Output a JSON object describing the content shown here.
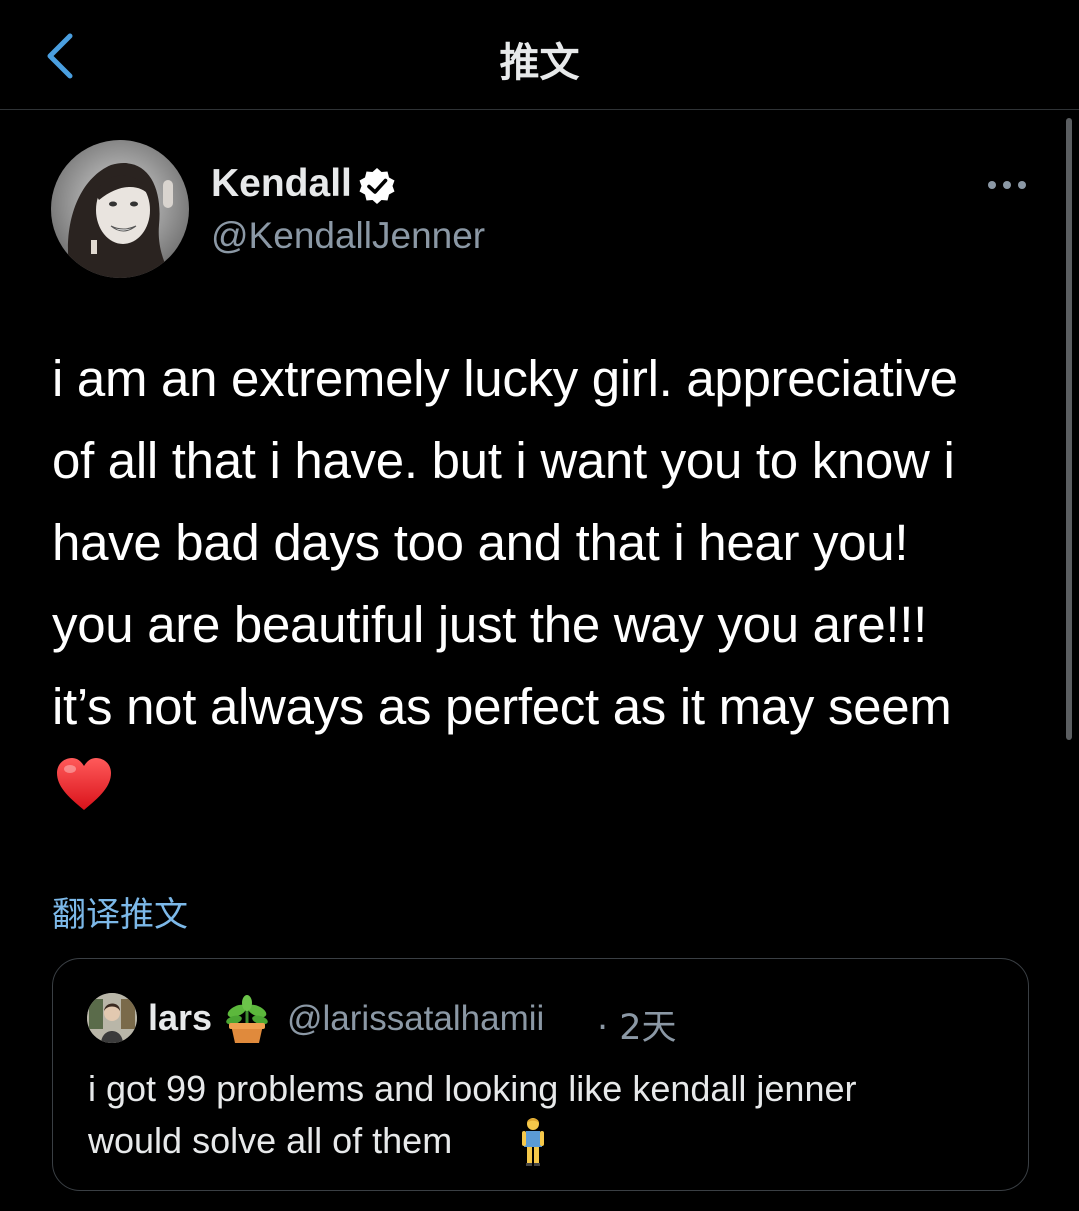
{
  "header": {
    "title": "推文",
    "back_icon": "chevron-left-icon"
  },
  "tweet": {
    "author_name": "Kendall",
    "author_handle": "@KendallJenner",
    "verified": true,
    "text": "i am an extremely lucky girl. appreciative\nof all that i have. but i want you to know i\nhave bad days too and that i hear you!\nyou are beautiful just the way you are!!!\nit’s not always as perfect as it may seem",
    "trailing_emoji": "heart-emoji",
    "translate_label": "翻译推文"
  },
  "quoted_tweet": {
    "author_name": "lars",
    "name_emoji": "potted-plant-emoji",
    "author_handle": "@larissatalhamii",
    "separator": "·",
    "time": "2天",
    "text": "i got 99 problems and looking like kendall jenner\nwould solve all of them",
    "trailing_emoji": "standing-woman-emoji"
  },
  "colors": {
    "background": "#000000",
    "text": "#e7e9ea",
    "secondary_text": "#8b98a5",
    "link": "#7cb8e8",
    "verified_badge": "#ffffff",
    "border": "#2f3336"
  }
}
